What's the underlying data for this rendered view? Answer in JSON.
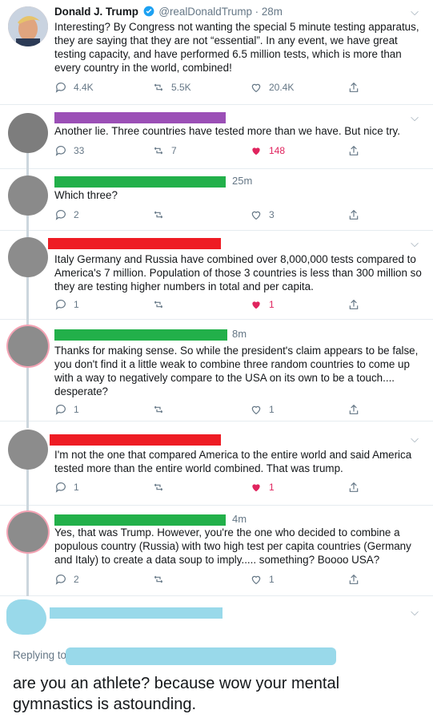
{
  "colors": {
    "purple": "#9b4fb6",
    "green": "#22b04a",
    "red": "#ee1c24",
    "light_blue": "#99d9ea",
    "like_red": "#e0245e",
    "muted": "#657786"
  },
  "main_tweet": {
    "name": "Donald J. Trump",
    "handle": "@realDonaldTrump",
    "time": "· 28m",
    "text": "Interesting? By Congress not wanting the special 5 minute testing apparatus, they are saying that they are not “essential”.  In any event, we have great testing capacity, and have performed 6.5 million tests, which is more than every country in the world, combined!",
    "replies": "4.4K",
    "retweets": "5.5K",
    "likes": "20.4K"
  },
  "replies": [
    {
      "text": "Another lie. Three countries have tested more than we have. But nice try.",
      "time": "",
      "replies": "33",
      "retweets": "7",
      "likes": "148",
      "liked": true
    },
    {
      "text": "Which three?",
      "time": "25m",
      "replies": "2",
      "retweets": "",
      "likes": "3",
      "liked": false
    },
    {
      "text": "Italy Germany and Russia have combined over 8,000,000 tests compared to America's 7 million. Population of those 3 countries is less than 300 million so they are testing higher numbers in total and per capita.",
      "time": "",
      "replies": "1",
      "retweets": "",
      "likes": "1",
      "liked": true
    },
    {
      "text": "Thanks for making sense. So while the president's claim appears to be false, you don't find it a little weak to combine three random countries to come up with a way to negatively compare to the USA on its own to be a touch.... desperate?",
      "time": "8m",
      "replies": "1",
      "retweets": "",
      "likes": "1",
      "liked": false
    },
    {
      "text": "I'm not the one that compared America to the entire world and said America tested more than the entire world combined. That was trump.",
      "time": "",
      "replies": "1",
      "retweets": "",
      "likes": "1",
      "liked": true
    },
    {
      "text": "Yes, that was Trump. However, you're the one who decided to combine a populous country (Russia) with two high test per capita countries (Germany and Italy) to create a data soup to imply..... something? Boooo USA?",
      "time": "4m",
      "replies": "2",
      "retweets": "",
      "likes": "1",
      "liked": false
    }
  ],
  "composer": {
    "replying_to": "Replying to",
    "text": "are you an athlete? because wow your mental gymnastics is astounding."
  }
}
